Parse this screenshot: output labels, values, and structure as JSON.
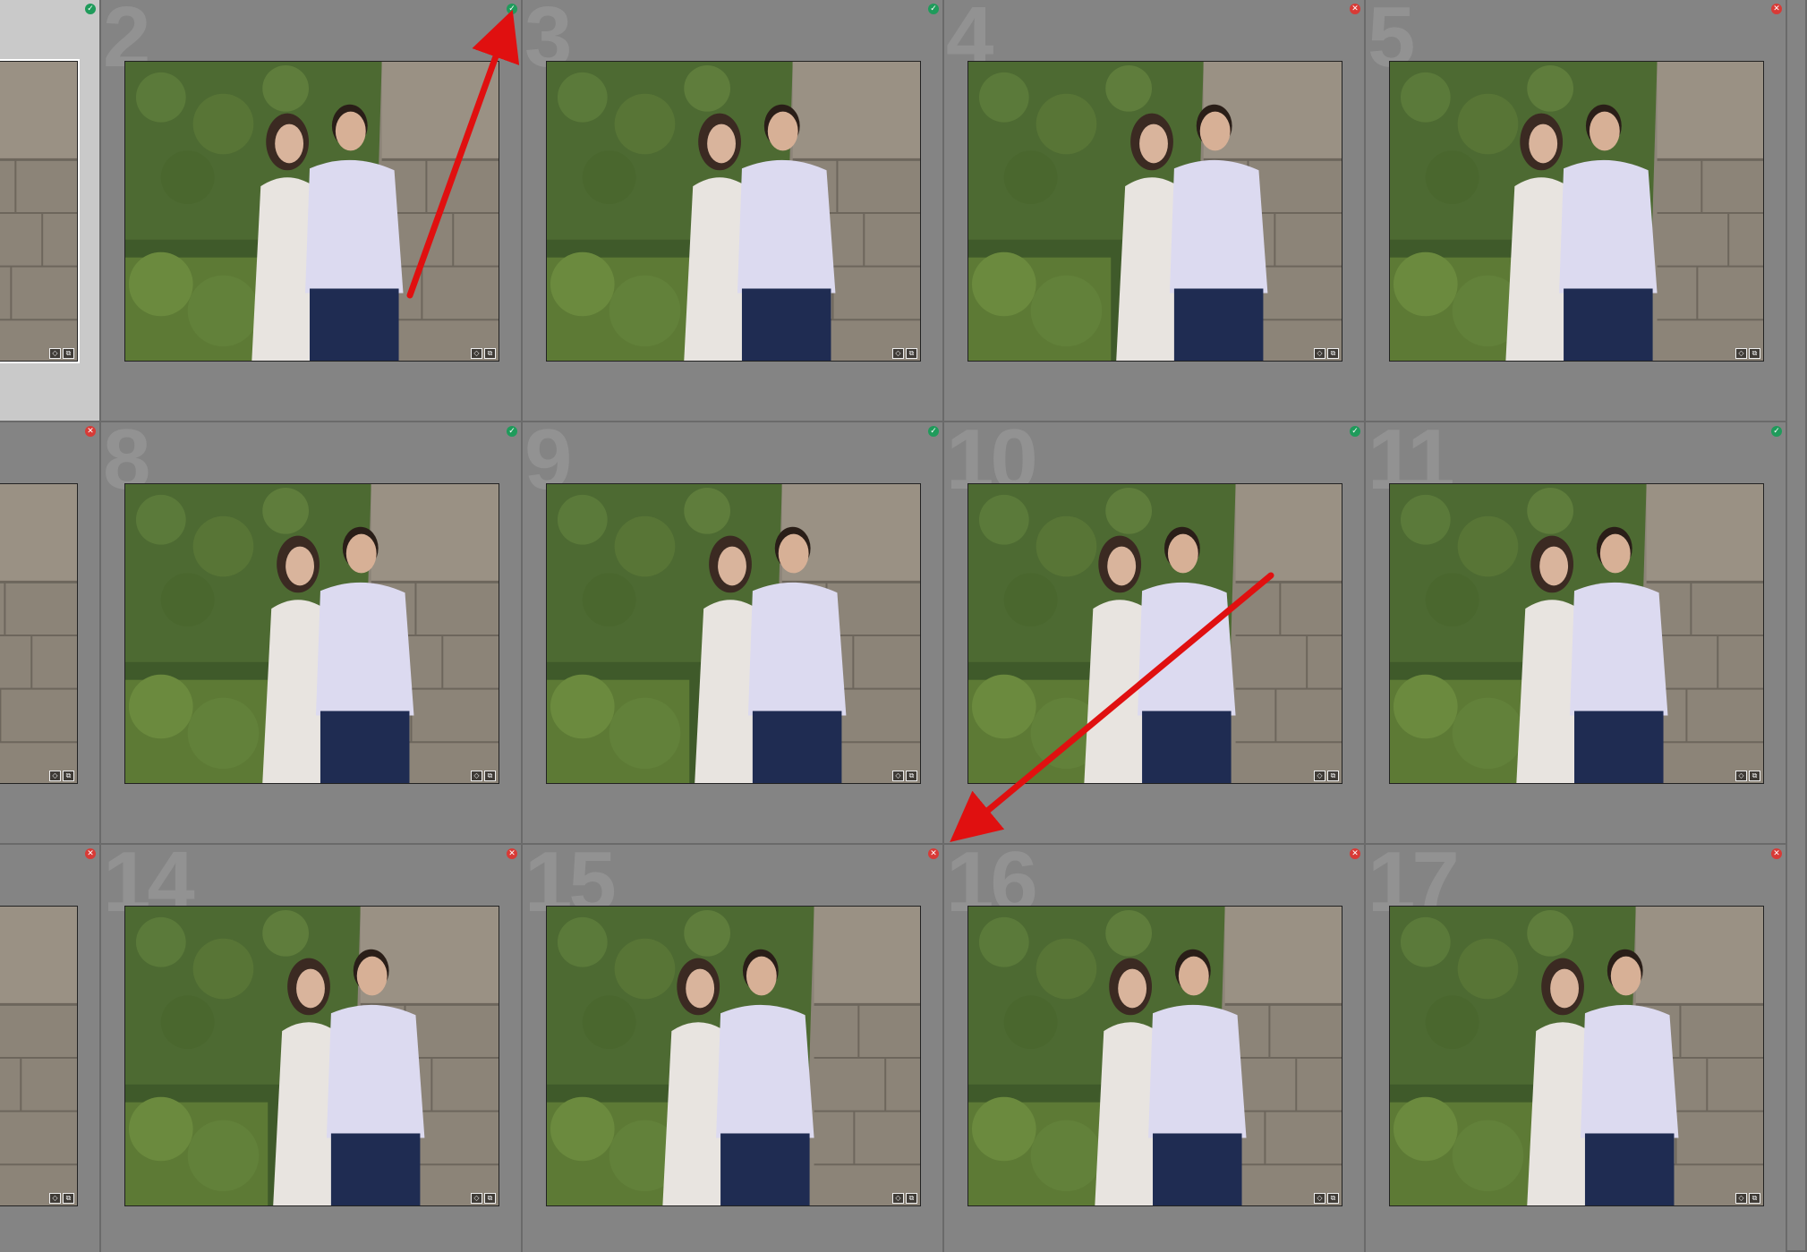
{
  "grid": {
    "cells": [
      {
        "row": 0,
        "col": 0,
        "number": "",
        "flag": "pick",
        "selected": true
      },
      {
        "row": 0,
        "col": 1,
        "number": "2",
        "flag": "pick",
        "selected": false
      },
      {
        "row": 0,
        "col": 2,
        "number": "3",
        "flag": "pick",
        "selected": false
      },
      {
        "row": 0,
        "col": 3,
        "number": "4",
        "flag": "reject",
        "selected": false
      },
      {
        "row": 0,
        "col": 4,
        "number": "5",
        "flag": "reject",
        "selected": false
      },
      {
        "row": 1,
        "col": 0,
        "number": "",
        "flag": "reject",
        "selected": false
      },
      {
        "row": 1,
        "col": 1,
        "number": "8",
        "flag": "pick",
        "selected": false
      },
      {
        "row": 1,
        "col": 2,
        "number": "9",
        "flag": "pick",
        "selected": false
      },
      {
        "row": 1,
        "col": 3,
        "number": "10",
        "flag": "pick",
        "selected": false
      },
      {
        "row": 1,
        "col": 4,
        "number": "11",
        "flag": "pick",
        "selected": false
      },
      {
        "row": 2,
        "col": 0,
        "number": "",
        "flag": "reject",
        "selected": false
      },
      {
        "row": 2,
        "col": 1,
        "number": "14",
        "flag": "reject",
        "selected": false
      },
      {
        "row": 2,
        "col": 2,
        "number": "15",
        "flag": "reject",
        "selected": false
      },
      {
        "row": 2,
        "col": 3,
        "number": "16",
        "flag": "reject",
        "selected": false
      },
      {
        "row": 2,
        "col": 4,
        "number": "17",
        "flag": "reject",
        "selected": false
      }
    ],
    "flag_icons": {
      "pick": "✓",
      "reject": "✕"
    },
    "badge_icons": [
      "tag-icon",
      "copy-icon"
    ],
    "badge_glyphs": [
      "◇",
      "⧉"
    ]
  },
  "colors": {
    "annotation_arrow": "#e01010",
    "pick_flag": "#1f9b5b",
    "reject_flag": "#d83a36",
    "cell_background": "#848484",
    "selected_cell_background": "#c9c9c9"
  },
  "annotations": [
    {
      "name": "annotation-arrow-to-pick-flag",
      "points_to": "pick flag of photo 2"
    },
    {
      "name": "annotation-arrow-to-reject-flag",
      "points_to": "reject flag of photo 15"
    }
  ]
}
